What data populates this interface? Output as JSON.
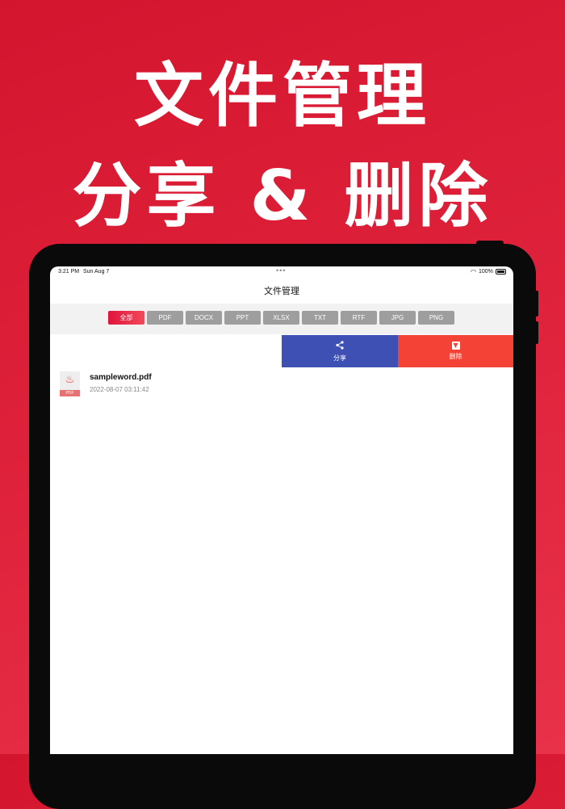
{
  "promo": {
    "line1": "文件管理",
    "line2": "分享 & 删除"
  },
  "status_bar": {
    "time": "3:21 PM",
    "date": "Sun Aug 7",
    "battery": "100%"
  },
  "nav": {
    "title": "文件管理"
  },
  "filters": {
    "active": "全部",
    "chips": [
      "全部",
      "PDF",
      "DOCX",
      "PPT",
      "XLSX",
      "TXT",
      "RTF",
      "JPG",
      "PNG"
    ]
  },
  "actions": {
    "share_label": "分享",
    "delete_label": "删除"
  },
  "files": [
    {
      "name": "sampleword.pdf",
      "date": "2022-08-07 03:11:42",
      "type_tag": "PDF"
    }
  ],
  "colors": {
    "background": "#dc1f37",
    "share": "#3e50b4",
    "delete": "#f44336",
    "chip_inactive": "#9e9e9e"
  }
}
